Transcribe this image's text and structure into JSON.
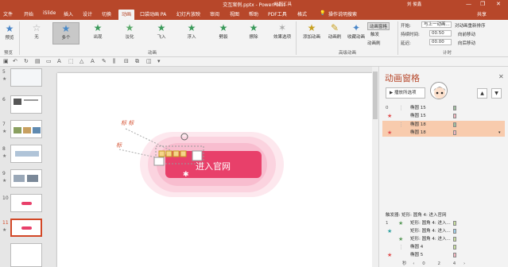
{
  "titlebar": {
    "title": "交互案例.pptx  -  PowerPoint",
    "tool_context": "绘图工具",
    "user": "刘 俊鑫",
    "minimize": "—",
    "restore": "❐",
    "close": "✕"
  },
  "tabs": [
    "文件",
    "开始",
    "iSlide",
    "插入",
    "设计",
    "切换",
    "动画",
    "口袋动画 PA",
    "幻灯片放映",
    "审阅",
    "视图",
    "帮助",
    "PDF工具",
    "格式"
  ],
  "active_tab": "动画",
  "tell_me": "操作说明搜索",
  "share": "共享",
  "ribbon": {
    "preview_label": "预览",
    "preview_group": "预览",
    "animations": [
      "无",
      "多个",
      "出现",
      "淡化",
      "飞入",
      "浮入",
      "劈裂",
      "擦除"
    ],
    "animation_group": "动画",
    "effect_options": "效果选项",
    "add_animation": "添加动画",
    "animation_painter": "动画刷",
    "trigger": "触发",
    "animation_pane_btn": "动画窗格",
    "advanced_group": "高级动画",
    "start_label": "开始:",
    "start_value": "与上一动画...",
    "duration_label": "持续时间:",
    "duration_value": "00.50",
    "delay_label": "延迟:",
    "delay_value": "00.00",
    "timing_group": "计时",
    "reorder_label": "对动画重新排序",
    "move_earlier": "向前移动",
    "move_later": "向后移动"
  },
  "slides": [
    {
      "num": "5",
      "star": "★"
    },
    {
      "num": "6",
      "star": ""
    },
    {
      "num": "7",
      "star": "★"
    },
    {
      "num": "8",
      "star": "★"
    },
    {
      "num": "9",
      "star": "★"
    },
    {
      "num": "10",
      "star": ""
    },
    {
      "num": "11",
      "star": "★"
    }
  ],
  "canvas": {
    "button_text": "进入官网",
    "tag_top": "标 标",
    "tag_left": "标"
  },
  "pane": {
    "title": "动画窗格",
    "close": "✕",
    "play_button": "▶  播放所选项",
    "up": "▲",
    "down": "▼",
    "items": [
      {
        "num": "0",
        "star": "★",
        "label": "椭圆 15",
        "color": "#f7a6a6",
        "bar": "#a0c0a0",
        "hl": false
      },
      {
        "num": "",
        "star": "★",
        "label": "椭圆 15",
        "color": "#e05050",
        "bar": "#f3b8c0",
        "hl": false
      },
      {
        "num": "",
        "star": "★",
        "label": "椭圆 18",
        "color": "#f7a6a6",
        "bar": "#a0c0a0",
        "hl": true
      },
      {
        "num": "",
        "star": "★",
        "label": "椭圆 18",
        "color": "#e05050",
        "bar": "#f3b8c0",
        "hl": true
      }
    ],
    "trigger_label": "触发器: 矩形: 圆角 4: 进入官网",
    "trigger_items": [
      {
        "num": "1",
        "star": "★",
        "label": "矩形: 圆角 4: 进入...",
        "color": "#5a9a5a",
        "bar": "#c8e0a0"
      },
      {
        "num": "",
        "star": "★",
        "label": "矩形: 圆角 4: 进入...",
        "color": "#30a0a0",
        "bar": "#a0d0e8"
      },
      {
        "num": "",
        "star": "★",
        "label": "矩形: 圆角 4: 进入...",
        "color": "#5a9a5a",
        "bar": "#c8e0a0"
      },
      {
        "num": "",
        "star": "★",
        "label": "椭圆 4",
        "color": "#f7a6a6",
        "bar": "#c8e0a0"
      },
      {
        "num": "",
        "star": "★",
        "label": "椭圆 5",
        "color": "#e05050",
        "bar": "#f3b8c0"
      }
    ]
  },
  "status": {
    "label": "秒",
    "ticks": [
      "0",
      "2",
      "4"
    ]
  }
}
